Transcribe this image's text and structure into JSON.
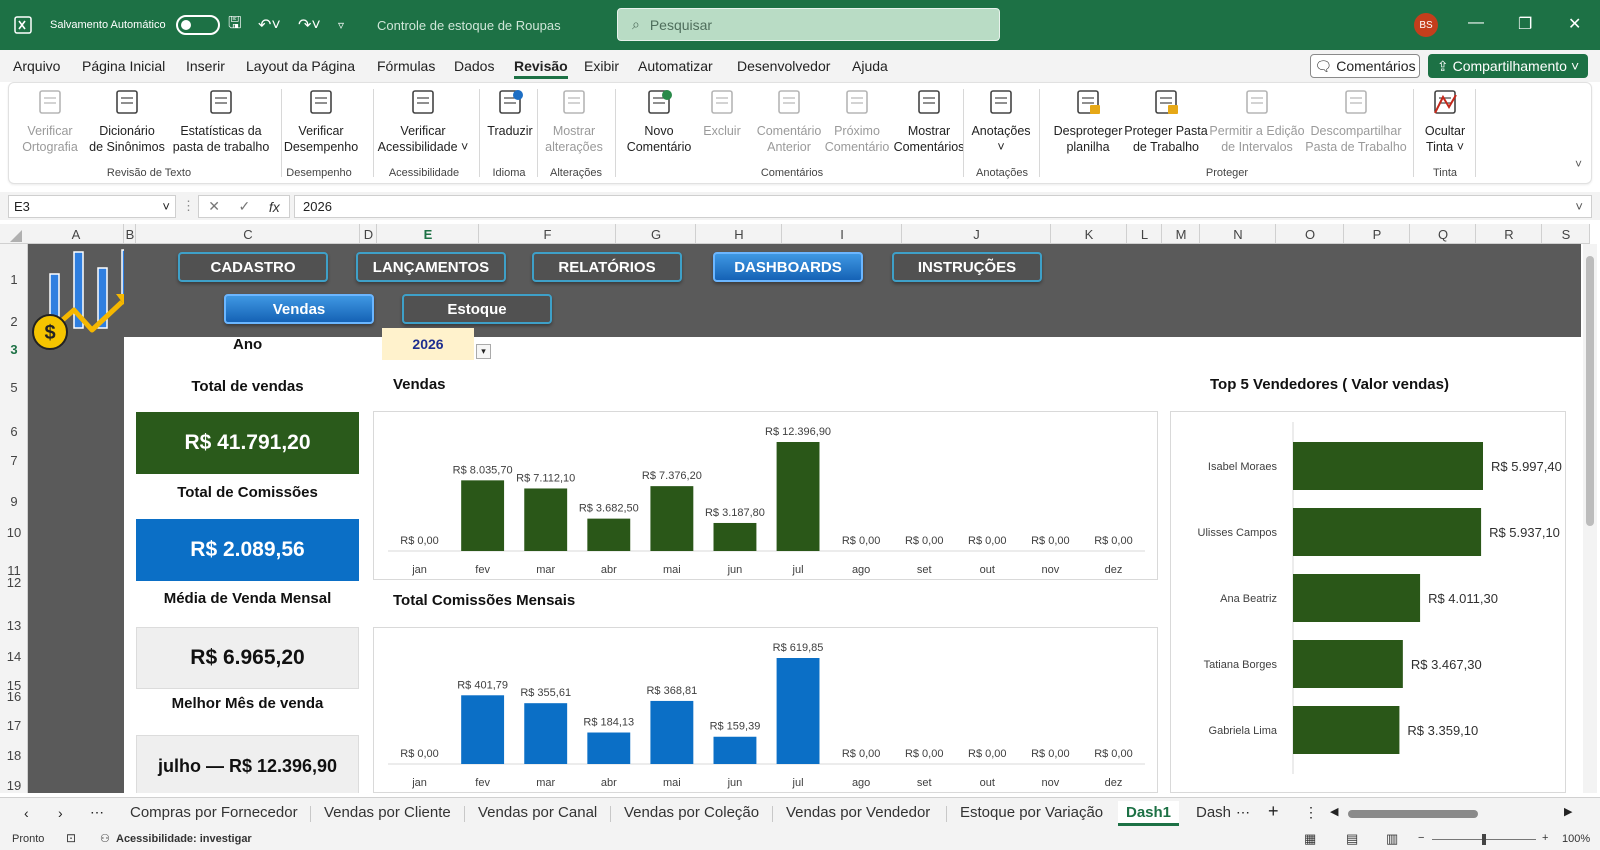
{
  "titlebar": {
    "autosave_label": "Salvamento Automático",
    "filename": "Controle de estoque de Roupas",
    "search_placeholder": "Pesquisar",
    "avatar": "BS"
  },
  "menu": {
    "items": [
      "Arquivo",
      "Página Inicial",
      "Inserir",
      "Layout da Página",
      "Fórmulas",
      "Dados",
      "Revisão",
      "Exibir",
      "Automatizar",
      "Desenvolvedor",
      "Ajuda"
    ],
    "active": "Revisão",
    "comments": "Comentários",
    "share": "Compartilhamento"
  },
  "ribbon": {
    "buttons": [
      {
        "l1": "Verificar",
        "l2": "Ortografia",
        "disabled": true
      },
      {
        "l1": "Dicionário",
        "l2": "de Sinônimos",
        "disabled": false
      },
      {
        "l1": "Estatísticas da",
        "l2": "pasta de trabalho",
        "disabled": false
      },
      {
        "l1": "Verificar",
        "l2": "Desempenho",
        "disabled": false
      },
      {
        "l1": "Verificar",
        "l2": "Acessibilidade ˅",
        "disabled": false
      },
      {
        "l1": "Traduzir",
        "l2": "",
        "disabled": false
      },
      {
        "l1": "Mostrar",
        "l2": "alterações",
        "disabled": true
      },
      {
        "l1": "Novo",
        "l2": "Comentário",
        "disabled": false
      },
      {
        "l1": "Excluir",
        "l2": "",
        "disabled": true
      },
      {
        "l1": "Comentário",
        "l2": "Anterior",
        "disabled": true
      },
      {
        "l1": "Próximo",
        "l2": "Comentário",
        "disabled": true
      },
      {
        "l1": "Mostrar",
        "l2": "Comentários",
        "disabled": false
      },
      {
        "l1": "Anotações",
        "l2": "˅",
        "disabled": false
      },
      {
        "l1": "Desproteger",
        "l2": "planilha",
        "disabled": false
      },
      {
        "l1": "Proteger Pasta",
        "l2": "de Trabalho",
        "disabled": false
      },
      {
        "l1": "Permitir a Edição",
        "l2": "de Intervalos",
        "disabled": true
      },
      {
        "l1": "Descompartilhar",
        "l2": "Pasta de Trabalho",
        "disabled": true
      },
      {
        "l1": "Ocultar",
        "l2": "Tinta ˅",
        "disabled": false
      }
    ],
    "groups": [
      "Revisão de Texto",
      "Desempenho",
      "Acessibilidade",
      "Idioma",
      "Alterações",
      "Comentários",
      "Anotações",
      "Proteger",
      "Tinta"
    ]
  },
  "formula": {
    "cell": "E3",
    "value": "2026",
    "fx": "fx"
  },
  "columns": [
    "A",
    "B",
    "C",
    "D",
    "E",
    "F",
    "G",
    "H",
    "I",
    "J",
    "K",
    "L",
    "M",
    "N",
    "O",
    "P",
    "Q",
    "R",
    "S"
  ],
  "rows": [
    "1",
    "2",
    "3",
    "5",
    "6",
    "7",
    "9",
    "10",
    "11",
    "12",
    "13",
    "14",
    "15",
    "16",
    "17",
    "18",
    "19"
  ],
  "nav": {
    "top": [
      "CADASTRO",
      "LANÇAMENTOS",
      "RELATÓRIOS",
      "DASHBOARDS",
      "INSTRUÇÕES"
    ],
    "sub": [
      "Vendas",
      "Estoque"
    ]
  },
  "filter": {
    "label": "Ano",
    "value": "2026"
  },
  "kpis": [
    {
      "label": "Total de vendas",
      "value": "R$ 41.791,20",
      "bg": "#2a5a1b",
      "fg": "#ffffff"
    },
    {
      "label": "Total de Comissões",
      "value": "R$ 2.089,56",
      "bg": "#0b6fc6",
      "fg": "#ffffff"
    },
    {
      "label": "Média de Venda Mensal",
      "value": "R$ 6.965,20",
      "bg": "#efefef",
      "fg": "#111111"
    },
    {
      "label": "Melhor Mês de venda",
      "value": "julho — R$ 12.396,90",
      "bg": "#efefef",
      "fg": "#111111"
    }
  ],
  "chart_data": [
    {
      "type": "bar",
      "title": "Vendas",
      "color": "#2a5718",
      "categories": [
        "jan",
        "fev",
        "mar",
        "abr",
        "mai",
        "jun",
        "jul",
        "ago",
        "set",
        "out",
        "nov",
        "dez"
      ],
      "values": [
        0,
        8035.7,
        7112.1,
        3682.5,
        7376.2,
        3187.8,
        12396.9,
        0,
        0,
        0,
        0,
        0
      ],
      "labels": [
        "R$ 0,00",
        "R$ 8.035,70",
        "R$ 7.112,10",
        "R$ 3.682,50",
        "R$ 7.376,20",
        "R$ 3.187,80",
        "R$ 12.396,90",
        "R$ 0,00",
        "R$ 0,00",
        "R$ 0,00",
        "R$ 0,00",
        "R$ 0,00"
      ]
    },
    {
      "type": "bar",
      "title": "Total Comissões Mensais",
      "color": "#0b6fc6",
      "categories": [
        "jan",
        "fev",
        "mar",
        "abr",
        "mai",
        "jun",
        "jul",
        "ago",
        "set",
        "out",
        "nov",
        "dez"
      ],
      "values": [
        0,
        401.79,
        355.61,
        184.13,
        368.81,
        159.39,
        619.85,
        0,
        0,
        0,
        0,
        0
      ],
      "labels": [
        "R$ 0,00",
        "R$ 401,79",
        "R$ 355,61",
        "R$ 184,13",
        "R$ 368,81",
        "R$ 159,39",
        "R$ 619,85",
        "R$ 0,00",
        "R$ 0,00",
        "R$ 0,00",
        "R$ 0,00",
        "R$ 0,00"
      ]
    },
    {
      "type": "bar",
      "orientation": "horizontal",
      "title": "Top 5 Vendedores ( Valor vendas)",
      "color": "#2a5718",
      "categories": [
        "Isabel Moraes",
        "Ulisses Campos",
        "Ana Beatriz",
        "Tatiana Borges",
        "Gabriela Lima"
      ],
      "values": [
        5997.4,
        5937.1,
        4011.3,
        3467.3,
        3359.1
      ],
      "labels": [
        "R$ 5.997,40",
        "R$ 5.937,10",
        "R$ 4.011,30",
        "R$ 3.467,30",
        "R$ 3.359,10"
      ]
    }
  ],
  "sheets": [
    "Compras por Fornecedor",
    "Vendas por Cliente",
    "Vendas por Canal",
    "Vendas por Coleção",
    "Vendas por Vendedor",
    "Estoque por Variação",
    "Dash1",
    "Dash"
  ],
  "active_sheet": "Dash1",
  "status": {
    "ready": "Pronto",
    "accessibility": "Acessibilidade: investigar",
    "zoom": "100%"
  }
}
